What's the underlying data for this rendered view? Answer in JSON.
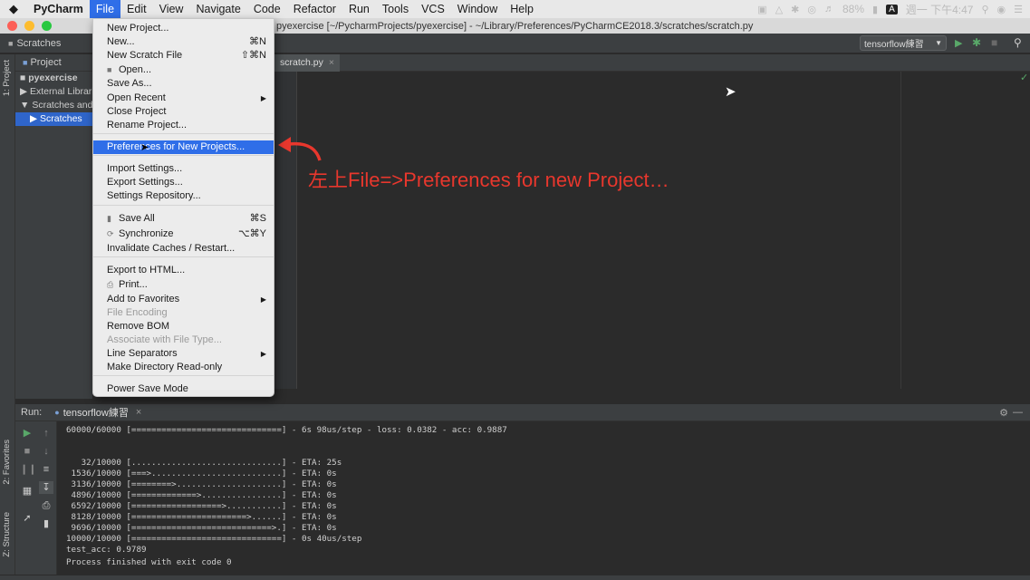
{
  "menubar": {
    "apple": "",
    "app": "PyCharm",
    "items": [
      "File",
      "Edit",
      "View",
      "Navigate",
      "Code",
      "Refactor",
      "Run",
      "Tools",
      "VCS",
      "Window",
      "Help"
    ],
    "status": {
      "battery": "88%",
      "input": "A",
      "clock": "週一 下午4:47"
    }
  },
  "window": {
    "title": "pyexercise [~/PycharmProjects/pyexercise] - ~/Library/Preferences/PyCharmCE2018.3/scratches/scratch.py"
  },
  "toolbar": {
    "breadcrumb": "Scratches",
    "run_config": "tensorflow練習"
  },
  "side_tabs": {
    "project": "1: Project",
    "favorites": "2: Favorites",
    "structure": "Z: Structure"
  },
  "project": {
    "header": "Project",
    "tree": [
      "pyexercise",
      "External Libraries",
      "Scratches and Consoles",
      "Scratches"
    ]
  },
  "editor": {
    "tab": "scratch.py"
  },
  "annotation": "左上File=>Preferences for new Project…",
  "file_menu": [
    {
      "label": "New Project..."
    },
    {
      "label": "New...",
      "shortcut": "⌘N"
    },
    {
      "label": "New Scratch File",
      "shortcut": "⇧⌘N"
    },
    {
      "label": "Open...",
      "icon": "folder-icon"
    },
    {
      "label": "Save As..."
    },
    {
      "label": "Open Recent",
      "submenu": true
    },
    {
      "label": "Close Project"
    },
    {
      "label": "Rename Project..."
    },
    {
      "label": "Preferences for New Projects..."
    },
    {
      "label": "Import Settings..."
    },
    {
      "label": "Export Settings..."
    },
    {
      "label": "Settings Repository..."
    },
    {
      "label": "Save All",
      "shortcut": "⌘S",
      "icon": "save-icon"
    },
    {
      "label": "Synchronize",
      "shortcut": "⌥⌘Y",
      "icon": "sync-icon"
    },
    {
      "label": "Invalidate Caches / Restart..."
    },
    {
      "label": "Export to HTML..."
    },
    {
      "label": "Print...",
      "icon": "print-icon"
    },
    {
      "label": "Add to Favorites",
      "submenu": true
    },
    {
      "label": "File Encoding",
      "disabled": true
    },
    {
      "label": "Remove BOM"
    },
    {
      "label": "Associate with File Type...",
      "disabled": true
    },
    {
      "label": "Line Separators",
      "submenu": true
    },
    {
      "label": "Make Directory Read-only"
    },
    {
      "label": "Power Save Mode"
    }
  ],
  "run": {
    "label": "Run:",
    "tab": "tensorflow練習",
    "console": [
      "60000/60000 [==============================] - 6s 98us/step - loss: 0.0382 - acc: 0.9887",
      "",
      "   32/10000 [..............................] - ETA: 25s",
      " 1536/10000 [===>..........................] - ETA: 0s",
      " 3136/10000 [========>.....................] - ETA: 0s",
      " 4896/10000 [=============>................] - ETA: 0s",
      " 6592/10000 [==================>...........] - ETA: 0s",
      " 8128/10000 [=======================>......] - ETA: 0s",
      " 9696/10000 [============================>.] - ETA: 0s",
      "10000/10000 [==============================] - 0s 40us/step",
      "test_acc: 0.9789",
      "",
      "Process finished with exit code 0"
    ]
  }
}
